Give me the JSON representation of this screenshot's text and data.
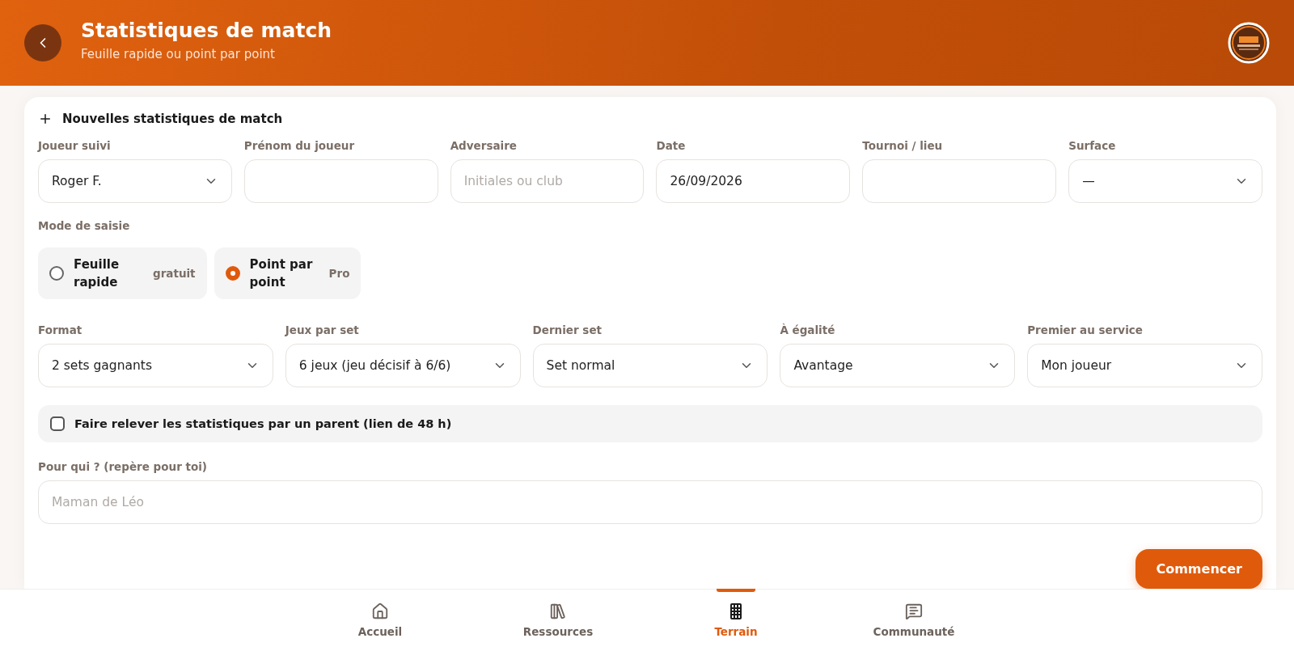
{
  "header": {
    "title": "Statistiques de match",
    "subtitle": "Feuille rapide ou point par point"
  },
  "form": {
    "title": "Nouvelles statistiques de match",
    "fields": [
      {
        "label": "Joueur suivi",
        "kind": "select",
        "value": "Roger F."
      },
      {
        "label": "Prénom du joueur",
        "kind": "text"
      },
      {
        "label": "Adversaire",
        "kind": "text",
        "placeholder": "Initiales ou club"
      },
      {
        "label": "Date",
        "kind": "date",
        "value": "26/09/2026"
      },
      {
        "label": "Tournoi / lieu",
        "kind": "text"
      },
      {
        "label": "Surface",
        "kind": "select",
        "value": "—"
      }
    ],
    "mode": {
      "label": "Mode de saisie",
      "options": [
        {
          "label": "Feuille rapide",
          "tag": "gratuit",
          "selected": false
        },
        {
          "label": "Point par point",
          "tag": "Pro",
          "selected": true
        }
      ]
    },
    "settings": [
      {
        "label": "Format",
        "value": "2 sets gagnants"
      },
      {
        "label": "Jeux par set",
        "value": "6 jeux (jeu décisif à 6/6)"
      },
      {
        "label": "Dernier set",
        "value": "Set normal"
      },
      {
        "label": "À égalité",
        "value": "Avantage"
      },
      {
        "label": "Premier au service",
        "value": "Mon joueur"
      }
    ],
    "parent": {
      "label": "Faire relever les statistiques par un parent (lien de 48 h)",
      "checked": false
    },
    "for_whom": {
      "label": "Pour qui ? (repère pour toi)",
      "placeholder": "Maman de Léo"
    },
    "submit": "Commencer"
  },
  "nav": [
    {
      "label": "Accueil",
      "kind": "home",
      "selected": false
    },
    {
      "label": "Ressources",
      "kind": "library",
      "selected": false
    },
    {
      "label": "Terrain",
      "kind": "court",
      "selected": true
    },
    {
      "label": "Communauté",
      "kind": "chat",
      "selected": false
    }
  ]
}
